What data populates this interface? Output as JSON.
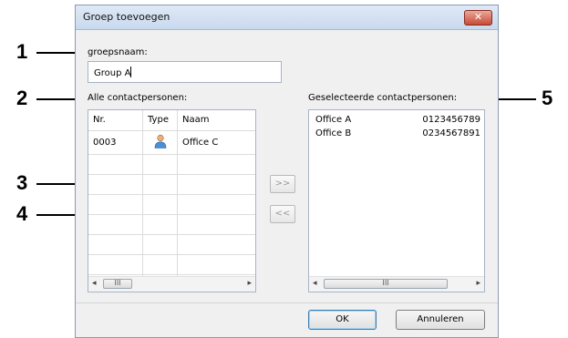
{
  "callouts": [
    "1",
    "2",
    "3",
    "4",
    "5"
  ],
  "dialog": {
    "title": "Groep toevoegen",
    "close_glyph": "✕",
    "group_name_label": "groepsnaam:",
    "group_name_value": "Group A",
    "all_contacts_label": "Alle contactpersonen:",
    "selected_contacts_label": "Geselecteerde contactpersonen:",
    "table": {
      "headers": [
        "Nr.",
        "Type",
        "Naam"
      ],
      "rows": [
        {
          "nr": "0003",
          "type_icon": "person-icon",
          "name": "Office C"
        }
      ]
    },
    "selected": [
      {
        "name": "Office A",
        "phone": "0123456789"
      },
      {
        "name": "Office B",
        "phone": "0234567891"
      }
    ],
    "scroll": {
      "left": "◂",
      "right": "▸",
      "thumb": "III"
    },
    "add_button": ">>",
    "remove_button": "<<",
    "ok_button": "OK",
    "cancel_button": "Annuleren"
  }
}
